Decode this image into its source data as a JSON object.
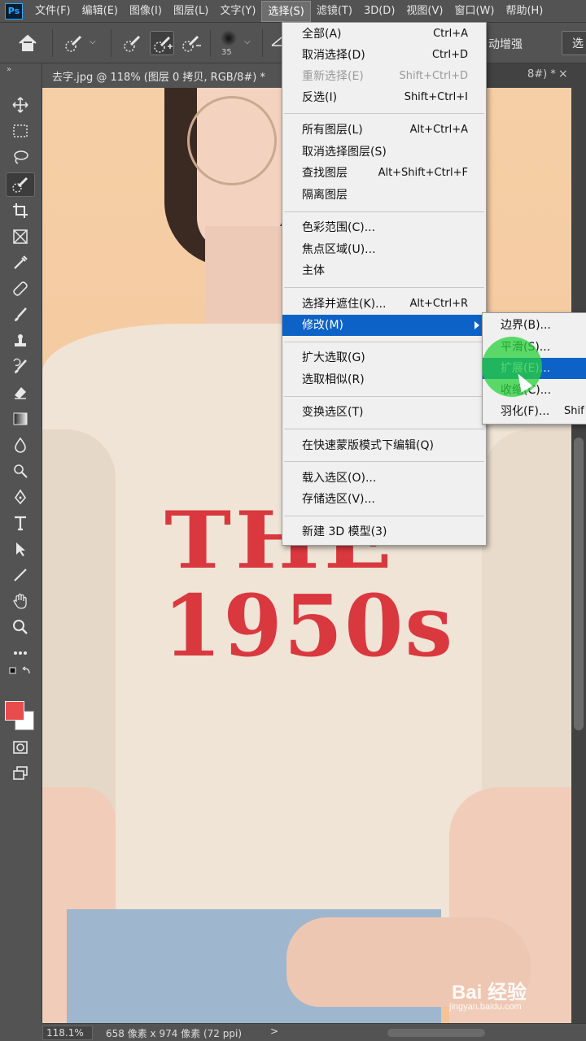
{
  "app": {
    "logo": "Ps"
  },
  "menubar": {
    "items": [
      "文件(F)",
      "编辑(E)",
      "图像(I)",
      "图层(L)",
      "文字(Y)",
      "选择(S)",
      "滤镜(T)",
      "3D(D)",
      "视图(V)",
      "窗口(W)",
      "帮助(H)"
    ],
    "active_index": 5
  },
  "options": {
    "brush_size": "35",
    "right_label": "动增强",
    "right_button": "选"
  },
  "tabs": {
    "active": "去字.jpg @ 118% (图层 0 拷贝, RGB/8#) *",
    "second": "8#) *",
    "close": "×"
  },
  "select_menu": {
    "items": [
      {
        "label": "全部(A)",
        "shortcut": "Ctrl+A",
        "disabled": false
      },
      {
        "label": "取消选择(D)",
        "shortcut": "Ctrl+D",
        "disabled": false
      },
      {
        "label": "重新选择(E)",
        "shortcut": "Shift+Ctrl+D",
        "disabled": true
      },
      {
        "label": "反选(I)",
        "shortcut": "Shift+Ctrl+I",
        "disabled": false
      },
      {
        "label": "所有图层(L)",
        "shortcut": "Alt+Ctrl+A",
        "disabled": false
      },
      {
        "label": "取消选择图层(S)",
        "shortcut": "",
        "disabled": false
      },
      {
        "label": "查找图层",
        "shortcut": "Alt+Shift+Ctrl+F",
        "disabled": false
      },
      {
        "label": "隔离图层",
        "shortcut": "",
        "disabled": false
      },
      {
        "label": "色彩范围(C)...",
        "shortcut": "",
        "disabled": false
      },
      {
        "label": "焦点区域(U)...",
        "shortcut": "",
        "disabled": false
      },
      {
        "label": "主体",
        "shortcut": "",
        "disabled": false
      },
      {
        "label": "选择并遮住(K)...",
        "shortcut": "Alt+Ctrl+R",
        "disabled": false
      },
      {
        "label": "修改(M)",
        "shortcut": "",
        "disabled": false
      },
      {
        "label": "扩大选取(G)",
        "shortcut": "",
        "disabled": false
      },
      {
        "label": "选取相似(R)",
        "shortcut": "",
        "disabled": false
      },
      {
        "label": "变换选区(T)",
        "shortcut": "",
        "disabled": false
      },
      {
        "label": "在快速蒙版模式下编辑(Q)",
        "shortcut": "",
        "disabled": false
      },
      {
        "label": "载入选区(O)...",
        "shortcut": "",
        "disabled": false
      },
      {
        "label": "存储选区(V)...",
        "shortcut": "",
        "disabled": false
      },
      {
        "label": "新建 3D 模型(3)",
        "shortcut": "",
        "disabled": false
      }
    ],
    "highlighted_index": 12
  },
  "modify_submenu": {
    "items": [
      {
        "label": "边界(B)...",
        "shortcut": ""
      },
      {
        "label": "平滑(S)...",
        "shortcut": ""
      },
      {
        "label": "扩展(E)...",
        "shortcut": ""
      },
      {
        "label": "收缩(C)...",
        "shortcut": ""
      },
      {
        "label": "羽化(F)...",
        "shortcut": "Shif"
      }
    ],
    "highlighted_index": 2
  },
  "canvas": {
    "shirt_line1": "THE",
    "shirt_line2": "1950s"
  },
  "colors": {
    "foreground": "#e84c4c",
    "background": "#ffffff",
    "menu_highlight": "#0d62c7"
  },
  "status": {
    "zoom": "118.1%",
    "doc_info": "658 像素 x 974 像素 (72 ppi)",
    "arrow": ">"
  },
  "watermark": {
    "brand": "Bai 经验",
    "url": "jingyan.baidu.com"
  }
}
